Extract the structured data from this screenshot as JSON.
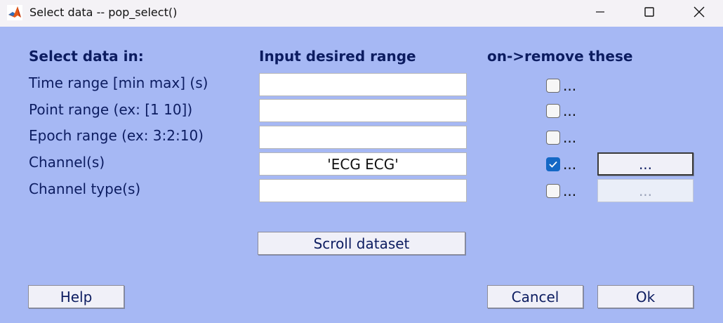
{
  "window": {
    "title": "Select data -- pop_select()",
    "icon": "matlab-logo-icon"
  },
  "headers": {
    "select_in": "Select data in:",
    "input_range": "Input desired range",
    "remove": "on->remove these"
  },
  "rows": [
    {
      "label": "Time range [min max] (s)",
      "value": "",
      "checked": false,
      "dots": "..."
    },
    {
      "label": "Point range (ex: [1 10])",
      "value": "",
      "checked": false,
      "dots": "..."
    },
    {
      "label": "Epoch range (ex: 3:2:10)",
      "value": "",
      "checked": false,
      "dots": "..."
    },
    {
      "label": "Channel(s)",
      "value": "'ECG ECG'",
      "checked": true,
      "dots": "...",
      "browse_label": "...",
      "browse_enabled": true
    },
    {
      "label": "Channel type(s)",
      "value": "",
      "checked": false,
      "dots": "...",
      "browse_label": "...",
      "browse_enabled": false
    }
  ],
  "scroll_button": "Scroll dataset",
  "footer": {
    "help": "Help",
    "cancel": "Cancel",
    "ok": "Ok"
  },
  "colors": {
    "background": "#a6b8f4",
    "text": "#0c1c60",
    "checkbox_checked": "#1468c5"
  }
}
